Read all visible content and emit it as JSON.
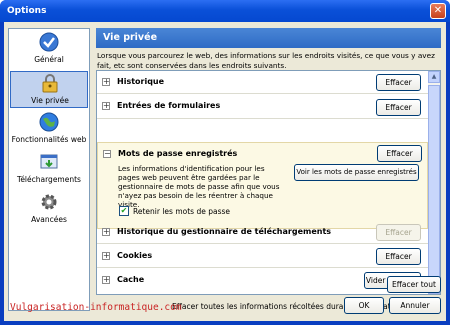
{
  "window": {
    "title": "Options",
    "close": "✕"
  },
  "sidebar": {
    "items": [
      {
        "label": "Général",
        "icon": "checkmark-icon"
      },
      {
        "label": "Vie privée",
        "icon": "lock-icon"
      },
      {
        "label": "Fonctionnalités web",
        "icon": "globe-icon"
      },
      {
        "label": "Téléchargements",
        "icon": "download-icon"
      },
      {
        "label": "Avancées",
        "icon": "gear-icon"
      }
    ],
    "selected": "Vie privée"
  },
  "header": {
    "title": "Vie privée"
  },
  "intro": "Lorsque vous parcourez le web, des informations sur les endroits visités, ce que vous y avez fait, etc sont conservées dans les endroits suivants.",
  "sections": [
    {
      "label": "Historique",
      "button": "Effacer",
      "expander": "+"
    },
    {
      "label": "Entrées de formulaires",
      "button": "Effacer",
      "expander": "+"
    },
    {
      "label": "Mots de passe enregistrés",
      "button": "Effacer",
      "expander": "−"
    },
    {
      "label": "Historique du gestionnaire de téléchargements",
      "button": "Effacer",
      "expander": "+"
    },
    {
      "label": "Cookies",
      "button": "Effacer",
      "expander": "+"
    },
    {
      "label": "Cache",
      "button": "Vider le cache",
      "expander": "+"
    }
  ],
  "passwords": {
    "description": "Les informations d'identification pour les pages web peuvent être gardées par le gestionnaire de mots de passe afin que vous n'ayez pas besoin de les réentrer à chaque visite.",
    "view_button": "Voir les mots de passe enregistrés",
    "checkbox_label": "Retenir les mots de passe",
    "checkbox_mark": "✔"
  },
  "footer": {
    "text": "Effacer toutes les informations récoltées durant la navigation :",
    "clear_all": "Effacer tout"
  },
  "buttons": {
    "ok": "OK",
    "cancel": "Annuler"
  },
  "watermark": "Vulgarisation-informatique.com",
  "scrollbar": {
    "up": "▲",
    "down": "▼"
  }
}
